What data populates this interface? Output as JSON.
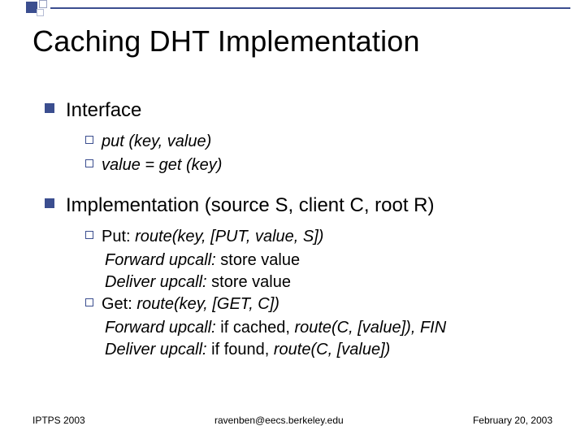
{
  "title": "Caching DHT Implementation",
  "sections": [
    {
      "heading": "Interface",
      "items": [
        {
          "prefix": "put",
          "rest": " (key, value)"
        },
        {
          "prefix": "value",
          "rest": " = get (key)"
        }
      ]
    },
    {
      "heading": "Implementation (source S, client C, root R)",
      "items": [
        {
          "label": "Put: ",
          "call": "route(key, [PUT, value, S])",
          "lines": [
            {
              "lead": "Forward upcall:",
              "rest": " store value"
            },
            {
              "lead": "Deliver upcall:",
              "rest": " store value"
            }
          ]
        },
        {
          "label": "Get: ",
          "call": "route(key, [GET, C])",
          "lines": [
            {
              "lead": "Forward upcall:",
              "rest_pre": " if cached, ",
              "rest_it": "route(C, [value]), FIN"
            },
            {
              "lead": "Deliver upcall:",
              "rest_pre": " if found, ",
              "rest_it": "route(C, [value])"
            }
          ]
        }
      ]
    }
  ],
  "footer": {
    "left": "IPTPS 2003",
    "center": "ravenben@eecs.berkeley.edu",
    "right": "February 20, 2003"
  }
}
